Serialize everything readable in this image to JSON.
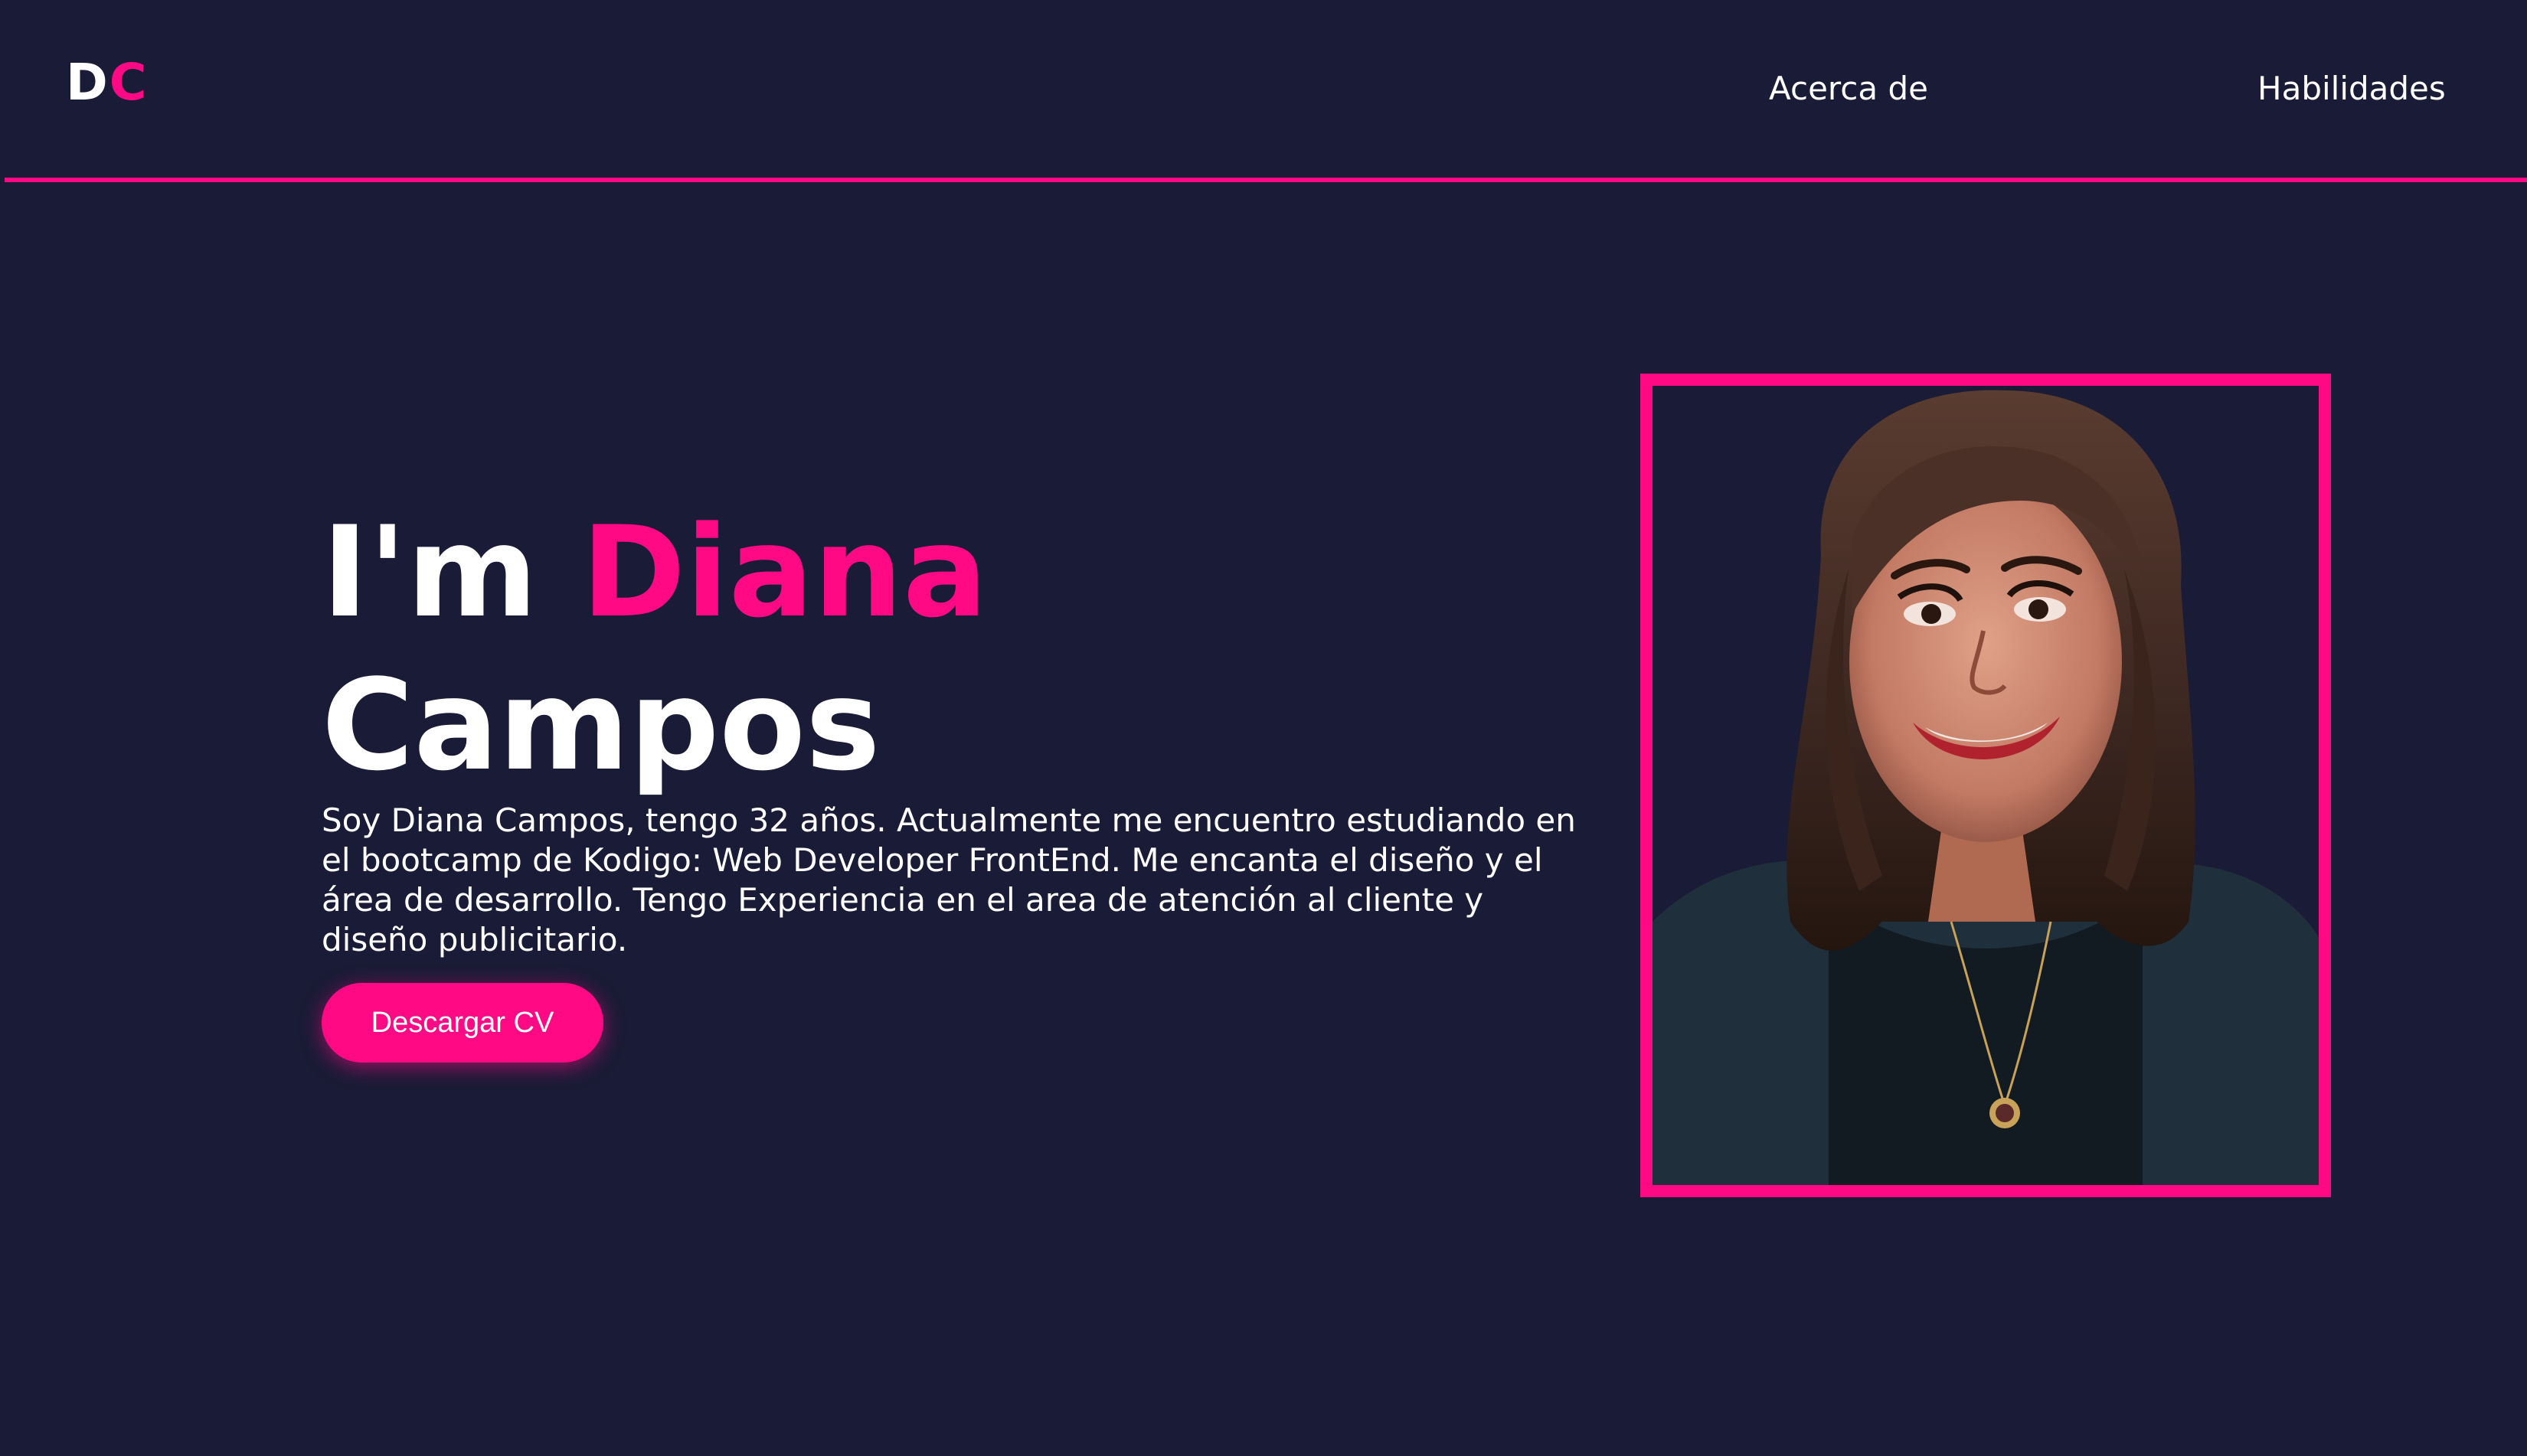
{
  "header": {
    "logo": {
      "letter1": "D",
      "letter2": "C"
    },
    "nav": [
      {
        "label": "Acerca de"
      },
      {
        "label": "Habilidades"
      }
    ]
  },
  "hero": {
    "title_prefix": "I'm ",
    "title_highlight": "Diana",
    "title_line2": "Campos",
    "description": "Soy Diana Campos, tengo 32 años. Actualmente me encuentro estudiando en el bootcamp de Kodigo: Web Developer FrontEnd. Me encanta el diseño y el área de desarrollo. Tengo Experiencia en el area de atención al cliente y diseño publicitario.",
    "cv_button": "Descargar CV"
  },
  "colors": {
    "background": "#1a1b36",
    "accent": "#ff0a84",
    "text": "#ffffff"
  }
}
